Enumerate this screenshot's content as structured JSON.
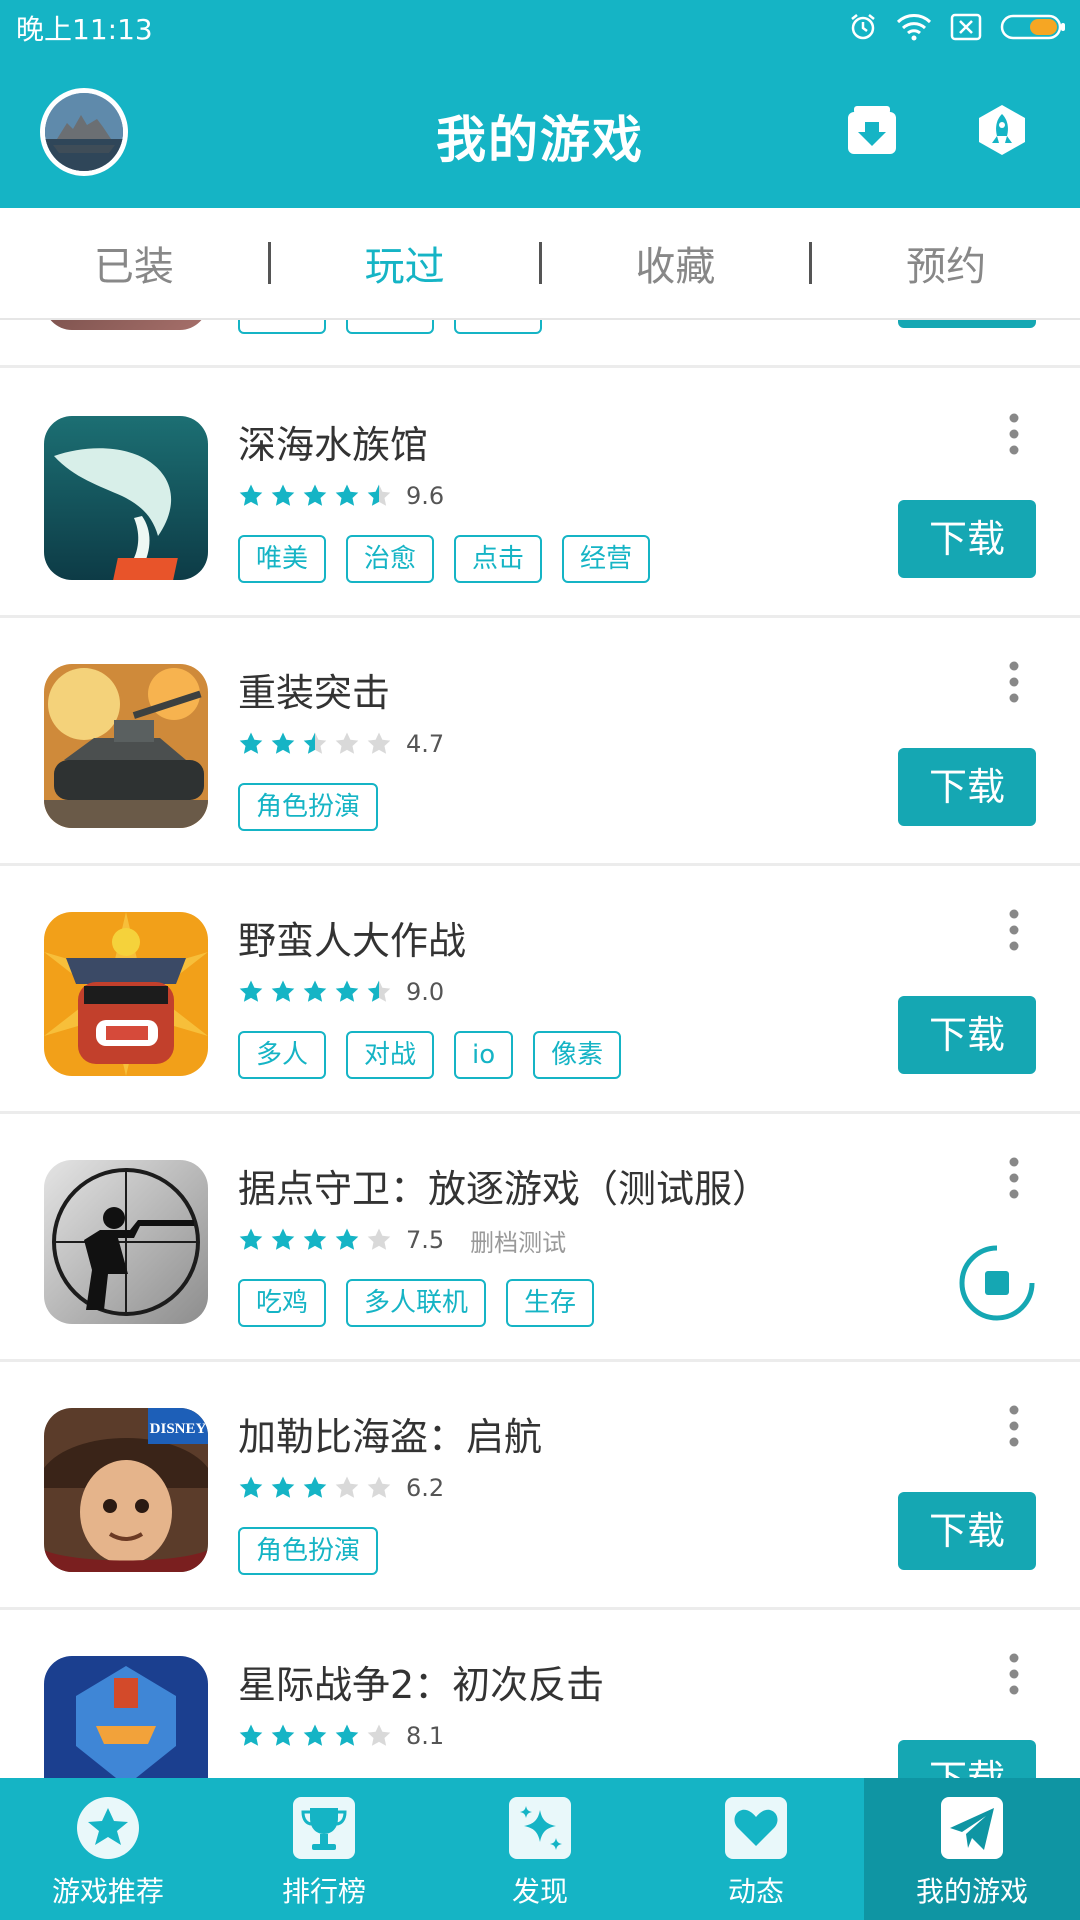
{
  "status": {
    "time": "晚上11:13"
  },
  "header": {
    "title": "我的游戏"
  },
  "tabs": [
    {
      "label": "已装"
    },
    {
      "label": "玩过"
    },
    {
      "label": "收藏"
    },
    {
      "label": "预约"
    }
  ],
  "games": [
    {
      "name": "深海水族馆",
      "rating": 9.6,
      "stars": 4.5,
      "score": "9.6",
      "tags": [
        "唯美",
        "治愈",
        "点击",
        "经营"
      ],
      "action": "下载"
    },
    {
      "name": "重装突击",
      "rating": 4.7,
      "stars": 2.5,
      "score": "4.7",
      "tags": [
        "角色扮演"
      ],
      "action": "下载"
    },
    {
      "name": "野蛮人大作战",
      "rating": 9.0,
      "stars": 4.5,
      "score": "9.0",
      "tags": [
        "多人",
        "对战",
        "io",
        "像素"
      ],
      "action": "下载"
    },
    {
      "name": "据点守卫：放逐游戏（测试服）",
      "rating": 7.5,
      "stars": 4,
      "score": "7.5",
      "note": "删档测试",
      "tags": [
        "吃鸡",
        "多人联机",
        "生存"
      ],
      "action": ""
    },
    {
      "name": "加勒比海盗：启航",
      "rating": 6.2,
      "stars": 3,
      "score": "6.2",
      "tags": [
        "角色扮演"
      ],
      "action": "下载"
    },
    {
      "name": "星际战争2：初次反击",
      "rating": 8.1,
      "stars": 4,
      "score": "8.1",
      "tags": [],
      "action": "下载"
    }
  ],
  "nav": [
    {
      "label": "游戏推荐",
      "icon": "star-icon"
    },
    {
      "label": "排行榜",
      "icon": "trophy-icon"
    },
    {
      "label": "发现",
      "icon": "sparkle-icon"
    },
    {
      "label": "动态",
      "icon": "heart-icon"
    },
    {
      "label": "我的游戏",
      "icon": "paper-plane-icon"
    }
  ],
  "colors": {
    "accent": "#15b4c5",
    "button": "#15a7b3",
    "nav_active": "#0f95a3"
  }
}
